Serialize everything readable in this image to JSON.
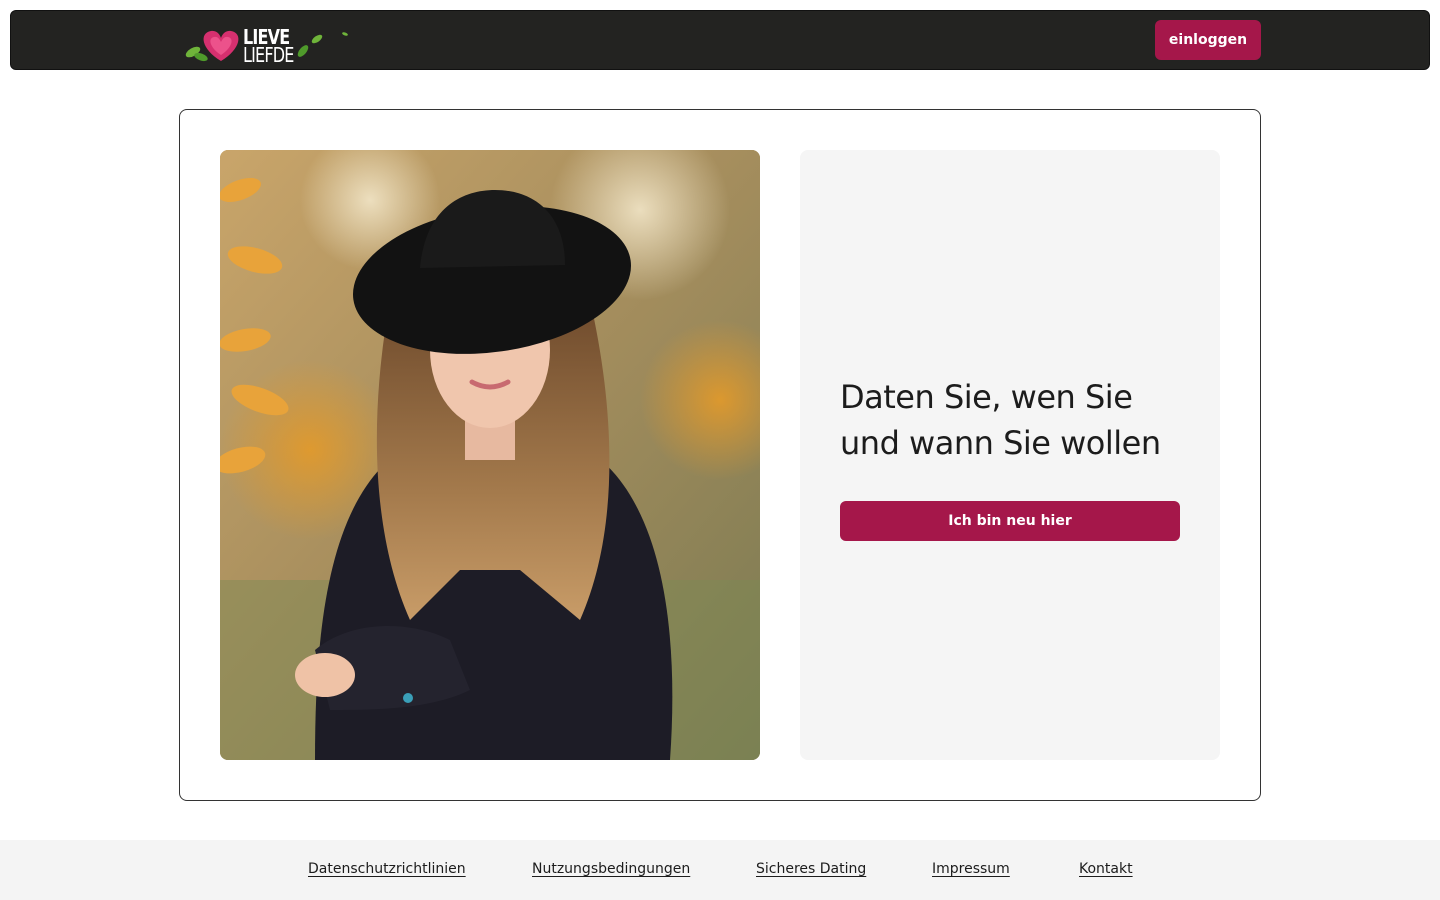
{
  "header": {
    "logo": {
      "line1": "LIEVE",
      "line2": "LIEFDE",
      "name": "heart-leaf-logo"
    },
    "login_label": "einloggen"
  },
  "hero": {
    "image_name": "woman-in-hat-autumn-photo",
    "headline_line1": "Daten Sie, wen Sie",
    "headline_line2": "und wann Sie wollen",
    "cta_label": "Ich bin neu hier"
  },
  "footer": {
    "links": [
      {
        "label": "Datenschutzrichtlinien"
      },
      {
        "label": "Nutzungsbedingungen"
      },
      {
        "label": "Sicheres Dating"
      },
      {
        "label": "Impressum"
      },
      {
        "label": "Kontakt"
      }
    ]
  },
  "colors": {
    "accent": "#a5174a",
    "header_bg": "#232321",
    "panel_bg": "#f5f5f5",
    "footer_bg": "#f4f4f4"
  }
}
